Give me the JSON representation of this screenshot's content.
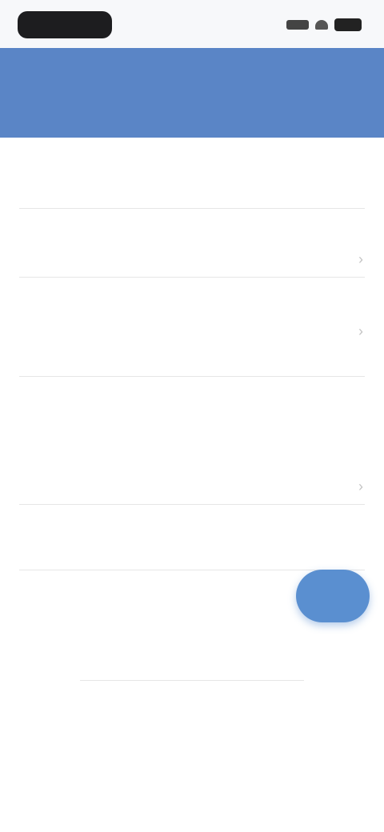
{
  "status": {
    "time": "",
    "battery_icon": "battery-icon",
    "wifi_icon": "wifi-icon",
    "signal_icon": "signal-icon"
  },
  "header": {
    "title": ""
  },
  "form": {
    "field1": {
      "label": "",
      "value": ""
    },
    "field2": {
      "label": "",
      "value": ""
    },
    "field3": {
      "label": "",
      "value": "",
      "helper": ""
    },
    "section4": {
      "label": "",
      "line1": "",
      "line2": "",
      "option": ""
    },
    "field5": {
      "label": "",
      "value": ""
    },
    "field6": {
      "label": "",
      "value": ""
    }
  },
  "footer": {
    "text1": "",
    "text2": "",
    "link": ""
  },
  "colors": {
    "header": "#5a85c6",
    "accent": "#5a8fd0"
  }
}
